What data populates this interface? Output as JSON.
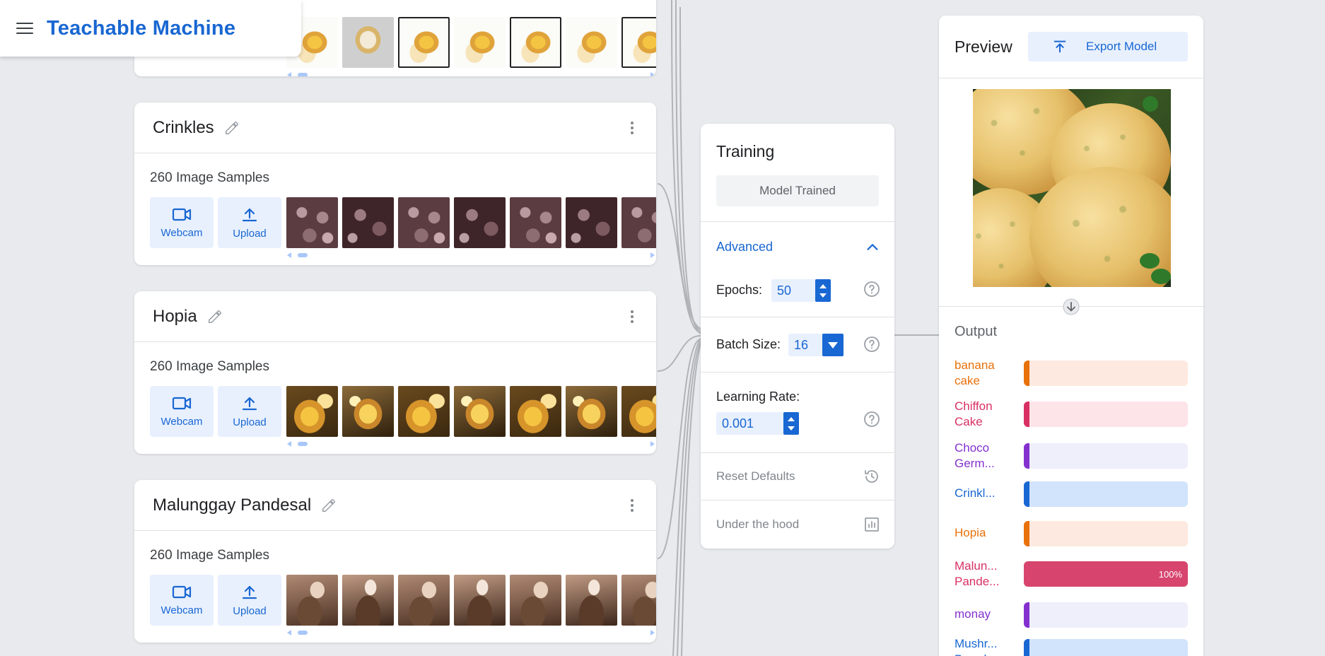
{
  "app": {
    "title": "Teachable Machine"
  },
  "classes": [
    {
      "name": "",
      "samples_label": "",
      "thumb_style": "cup"
    },
    {
      "name": "Crinkles",
      "samples_label": "260 Image Samples",
      "webcam_label": "Webcam",
      "upload_label": "Upload",
      "thumb_style": "crinkle"
    },
    {
      "name": "Hopia",
      "samples_label": "260 Image Samples",
      "webcam_label": "Webcam",
      "upload_label": "Upload",
      "thumb_style": "hopia"
    },
    {
      "name": "Malunggay Pandesal",
      "samples_label": "260 Image Samples",
      "webcam_label": "Webcam",
      "upload_label": "Upload",
      "thumb_style": "pandesal"
    }
  ],
  "training": {
    "title": "Training",
    "status_button": "Model Trained",
    "advanced_label": "Advanced",
    "epochs_label": "Epochs:",
    "epochs_value": "50",
    "batch_label": "Batch Size:",
    "batch_value": "16",
    "lr_label": "Learning Rate:",
    "lr_value": "0.001",
    "reset_label": "Reset Defaults",
    "hood_label": "Under the hood"
  },
  "preview": {
    "title": "Preview",
    "export_label": "Export Model",
    "output_label": "Output",
    "outputs": [
      {
        "name_lines": [
          "banana",
          "cake"
        ],
        "color": "#e8710a",
        "bg": "#fde9df",
        "percent": 0,
        "percent_label": ""
      },
      {
        "name_lines": [
          "Chiffon",
          "Cake"
        ],
        "color": "#d93063",
        "bg": "#fde4e8",
        "percent": 0,
        "percent_label": ""
      },
      {
        "name_lines": [
          "Choco",
          "Germ..."
        ],
        "color": "#8430ce",
        "bg": "#efeefb",
        "percent": 0,
        "percent_label": ""
      },
      {
        "name_lines": [
          "Crinkl..."
        ],
        "color": "#1967d2",
        "bg": "#d2e3fc",
        "percent": 0,
        "percent_label": ""
      },
      {
        "name_lines": [
          "Hopia"
        ],
        "color": "#e8710a",
        "bg": "#fde9df",
        "percent": 0,
        "percent_label": ""
      },
      {
        "name_lines": [
          "Malun...",
          "Pande..."
        ],
        "color": "#d93063",
        "bg": "#d93063",
        "fill": "#d7456e",
        "percent": 100,
        "percent_label": "100%"
      },
      {
        "name_lines": [
          "monay"
        ],
        "color": "#8430ce",
        "bg": "#efeefb",
        "percent": 0,
        "percent_label": ""
      },
      {
        "name_lines": [
          "Mushr...",
          "Bread"
        ],
        "color": "#1967d2",
        "bg": "#d2e3fc",
        "percent": 0,
        "percent_label": ""
      }
    ]
  }
}
